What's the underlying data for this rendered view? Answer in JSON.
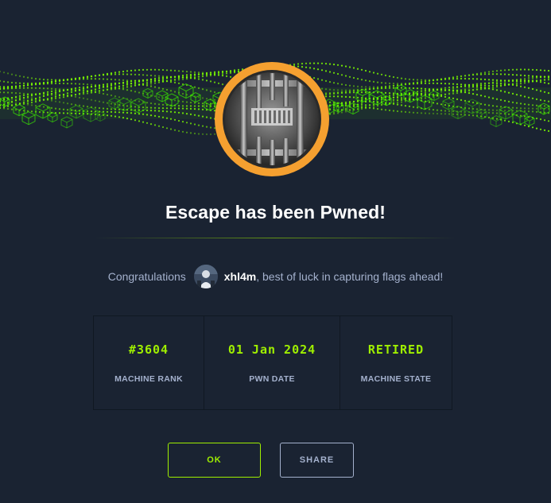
{
  "machine": {
    "name": "Escape",
    "title": "Escape has been Pwned!"
  },
  "congrats": {
    "prefix": "Congratulations",
    "username": "xhl4m",
    "suffix": ", best of luck in capturing flags ahead!"
  },
  "stats": [
    {
      "value": "#3604",
      "label": "MACHINE RANK"
    },
    {
      "value": "01 Jan 2024",
      "label": "PWN DATE"
    },
    {
      "value": "RETIRED",
      "label": "MACHINE STATE"
    }
  ],
  "buttons": {
    "ok": "OK",
    "share": "SHARE"
  },
  "colors": {
    "background": "#1a2332",
    "accent_green": "#9fef00",
    "badge_orange": "#f5a030",
    "muted_text": "#a4b1cd"
  },
  "icons": {
    "badge": "prison-bars-icon",
    "avatar": "user-avatar"
  }
}
